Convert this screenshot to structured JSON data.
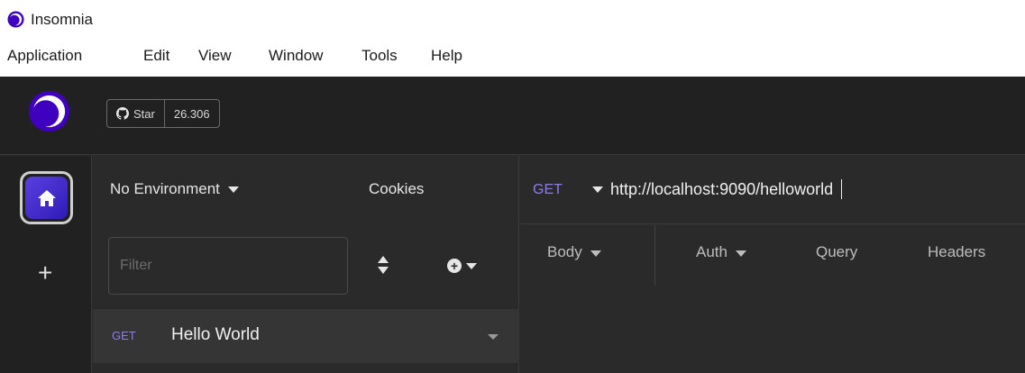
{
  "window": {
    "title": "Insomnia",
    "icon": "insomnia-logo-icon"
  },
  "menubar": {
    "items": [
      "Application",
      "Edit",
      "View",
      "Window",
      "Tools",
      "Help"
    ]
  },
  "topbar": {
    "logo": "insomnia-logo-icon",
    "star_label": "Star",
    "star_count": "26.306"
  },
  "rail": {
    "home_icon": "home-icon",
    "add_icon": "plus-icon"
  },
  "sidebar": {
    "environment": "No Environment",
    "cookies": "Cookies",
    "filter_placeholder": "Filter",
    "requests": [
      {
        "method": "GET",
        "name": "Hello World"
      }
    ]
  },
  "request": {
    "method": "GET",
    "url": "http://localhost:9090/helloworld",
    "tabs": [
      "Body",
      "Auth",
      "Query",
      "Headers"
    ]
  },
  "colors": {
    "accent": "#8f7bf0",
    "brand": "#4000bf",
    "dark_bg": "#2a2a2a"
  }
}
